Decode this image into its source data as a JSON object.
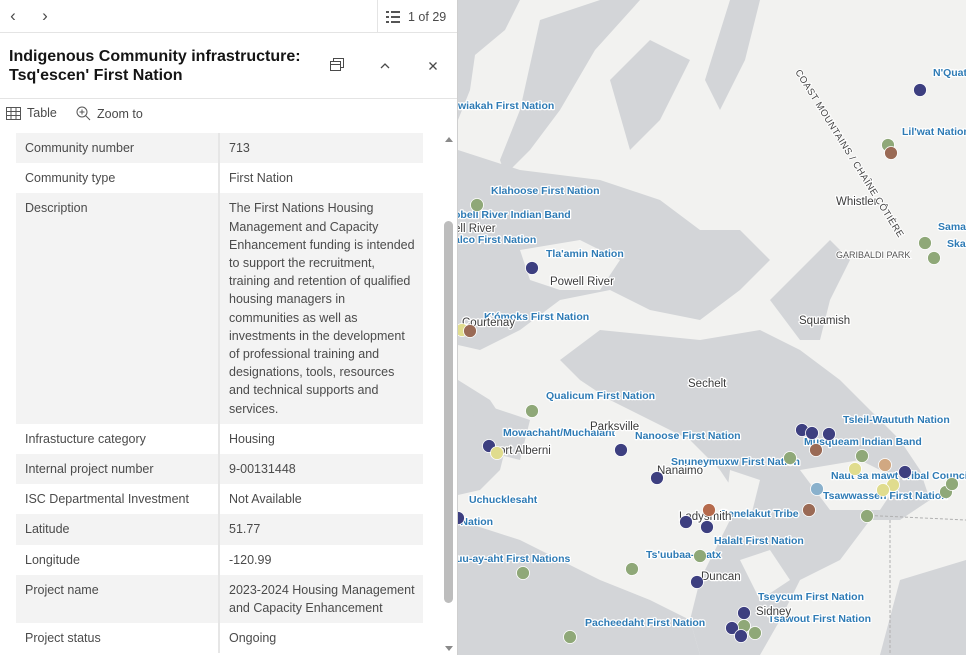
{
  "navigation": {
    "prev_icon": "chevron-left-icon",
    "next_icon": "chevron-right-icon",
    "record_count": "1 of 29"
  },
  "popup": {
    "title": "Indigenous Community infrastructure: Tsq'escen' First Nation",
    "dock_icon": "dock-icon",
    "collapse_icon": "chevron-up-icon",
    "close_icon": "close-icon"
  },
  "actions": {
    "table_label": "Table",
    "zoom_label": "Zoom to"
  },
  "fields": [
    {
      "key": "Community number",
      "value": "713"
    },
    {
      "key": "Community type",
      "value": "First Nation"
    },
    {
      "key": "Description",
      "value": "The First Nations Housing Management and Capacity Enhancement funding is intended to support the recruitment, training and retention of qualified housing managers in communities as well as investments in the development of professional training and designations, tools, resources and technical supports and services."
    },
    {
      "key": "Infrastucture category",
      "value": "Housing"
    },
    {
      "key": "Internal project number",
      "value": "9-00131448"
    },
    {
      "key": "ISC Departmental Investment",
      "value": "Not Available"
    },
    {
      "key": "Latitude",
      "value": "51.77"
    },
    {
      "key": "Longitude",
      "value": "-120.99"
    },
    {
      "key": "Project name",
      "value": "2023-2024 Housing Management and Capacity Enhancement"
    },
    {
      "key": "Project status",
      "value": "Ongoing"
    }
  ],
  "map": {
    "colors": {
      "land": "#f2f2f0",
      "water": "#d3d5d8",
      "label_first_nation": "#2e7bb5",
      "dot_navy": "#3d3f80",
      "dot_green": "#8fa878",
      "dot_brown": "#9a6a55",
      "dot_tan": "#d1a882",
      "dot_yellow": "#e0dc8e",
      "dot_blue": "#8ab1cc",
      "dot_rust": "#b56a4c"
    },
    "first_nation_labels": [
      "N'Quat",
      "wiakah First Nation",
      "Lil'wat Nation",
      "Klahoose First Nation",
      "obell River Indian Band",
      "alco First Nation",
      "Tla'amin Nation",
      "Sama",
      "Ska",
      "K'ómoks First Nation",
      "Qualicum First Nation",
      "Tsleil-Waututh Nation",
      "Mowachaht/Muchalaht",
      "Nanoose First Nation",
      "Musqueam Indian Band",
      "Snuneymuxw First Nation",
      "Naut'sa mawt Tribal Council",
      "Tsawwassen First Nation",
      "Uchucklesaht",
      "Penelakut Tribe",
      "t Nation",
      "Halalt First Nation",
      "uu-ay-aht First Nations",
      "Ts'uubaa-asatx",
      "Tseycum First Nation",
      "Tsawout First Nation",
      "Pacheedaht First Nation"
    ],
    "city_labels": [
      "ell River",
      "Powell River",
      "Courtenay",
      "Whistler",
      "Squamish",
      "Sechelt",
      "Parksville",
      "ort Alberni",
      "Nanaimo",
      "Ladysmith",
      "Duncan",
      "Sidney"
    ],
    "park_labels": [
      "GARIBALDI PARK"
    ],
    "mountain_label": "COAST MOUNTAINS / CHAÎNE CÔTIÈRE"
  }
}
